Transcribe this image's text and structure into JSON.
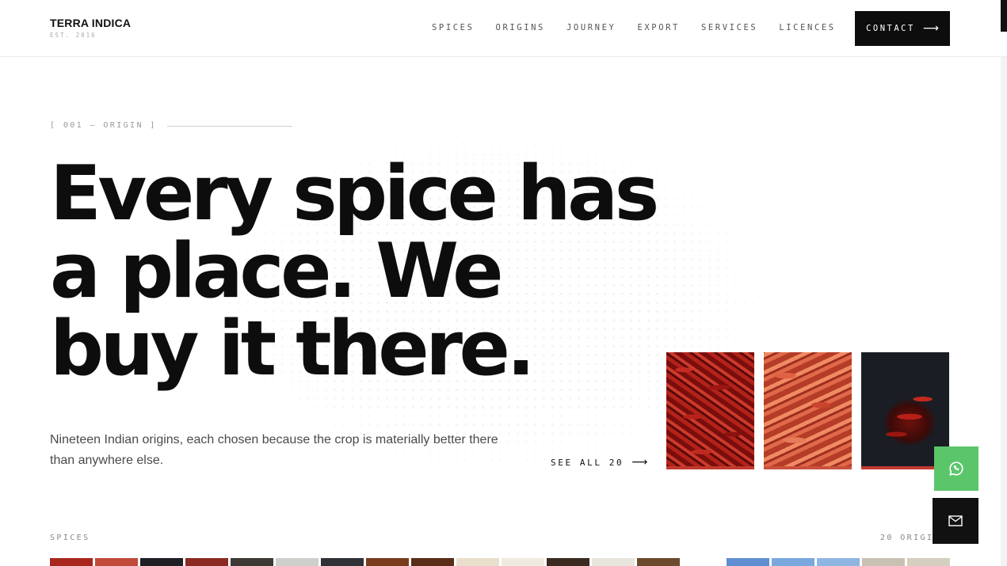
{
  "brand": {
    "name": "TERRA INDICA",
    "est": "EST. 2016"
  },
  "nav": {
    "items": [
      "SPICES",
      "ORIGINS",
      "JOURNEY",
      "EXPORT",
      "SERVICES",
      "LICENCES"
    ],
    "contact_label": "CONTACT"
  },
  "hero": {
    "section_label": "[ 001 — ORIGIN ]",
    "title_lines": [
      "Every spice has",
      "a place. We",
      "buy it there."
    ],
    "subtitle": "Nineteen Indian origins, each chosen because the crop is materially better there than anywhere else.",
    "see_all": "SEE ALL 20"
  },
  "cards": [
    {
      "image": "dried red chillies",
      "accent": "#c23a2f"
    },
    {
      "image": "dried red chillies close-up",
      "accent": "#c9513d"
    },
    {
      "image": "red chillies on dark background",
      "accent": "#c23a2f"
    }
  ],
  "floating": {
    "whatsapp_icon": "whatsapp-icon",
    "mail_icon": "mail-icon",
    "whatsapp_color": "#5bc56a"
  },
  "strip": {
    "spices_label": "SPICES",
    "origins_label": "20 ORIGINS",
    "spice_thumb_colors": [
      "#a8261d",
      "#c24a3a",
      "#1f1f24",
      "#8a2a22",
      "#3d3a36",
      "#cfcfcb",
      "#2f3236",
      "#7a3b1d",
      "#5a2d18",
      "#e9dfcc",
      "#f0ebe0",
      "#3a2a20",
      "#e8e5dd",
      "#6b4a2e"
    ],
    "origin_thumb_colors": [
      "#5f8fd1",
      "#7aa7de",
      "#8fb5e2",
      "#c9c1b2",
      "#d6cfc0"
    ]
  }
}
